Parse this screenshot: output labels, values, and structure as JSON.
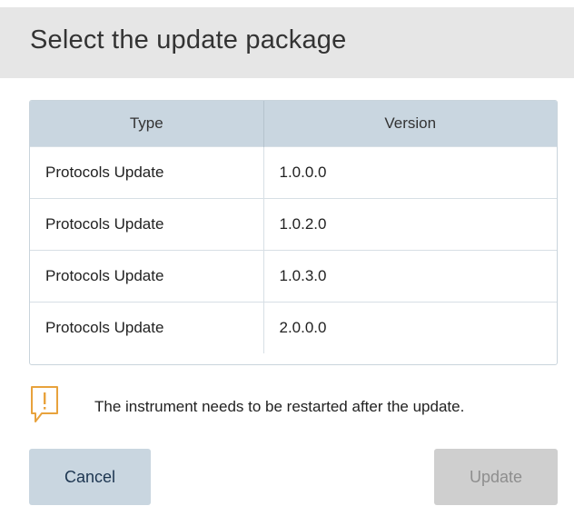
{
  "dialog": {
    "title": "Select the update package"
  },
  "table": {
    "headers": [
      "Type",
      "Version"
    ],
    "rows": [
      {
        "type": "Protocols Update",
        "version": "1.0.0.0"
      },
      {
        "type": "Protocols Update",
        "version": "1.0.2.0"
      },
      {
        "type": "Protocols Update",
        "version": "1.0.3.0"
      },
      {
        "type": "Protocols Update",
        "version": "2.0.0.0"
      }
    ]
  },
  "warning": {
    "icon": "exclamation-speech-bubble-icon",
    "text": "The instrument needs to be restarted after the update."
  },
  "buttons": {
    "cancel_label": "Cancel",
    "update_label": "Update",
    "update_enabled": false
  },
  "colors": {
    "header_bg": "#e6e6e6",
    "table_header_bg": "#c9d6e0",
    "warning_icon": "#e8a23c",
    "cancel_bg": "#c9d6e0",
    "update_disabled_bg": "#cfcfcf"
  }
}
